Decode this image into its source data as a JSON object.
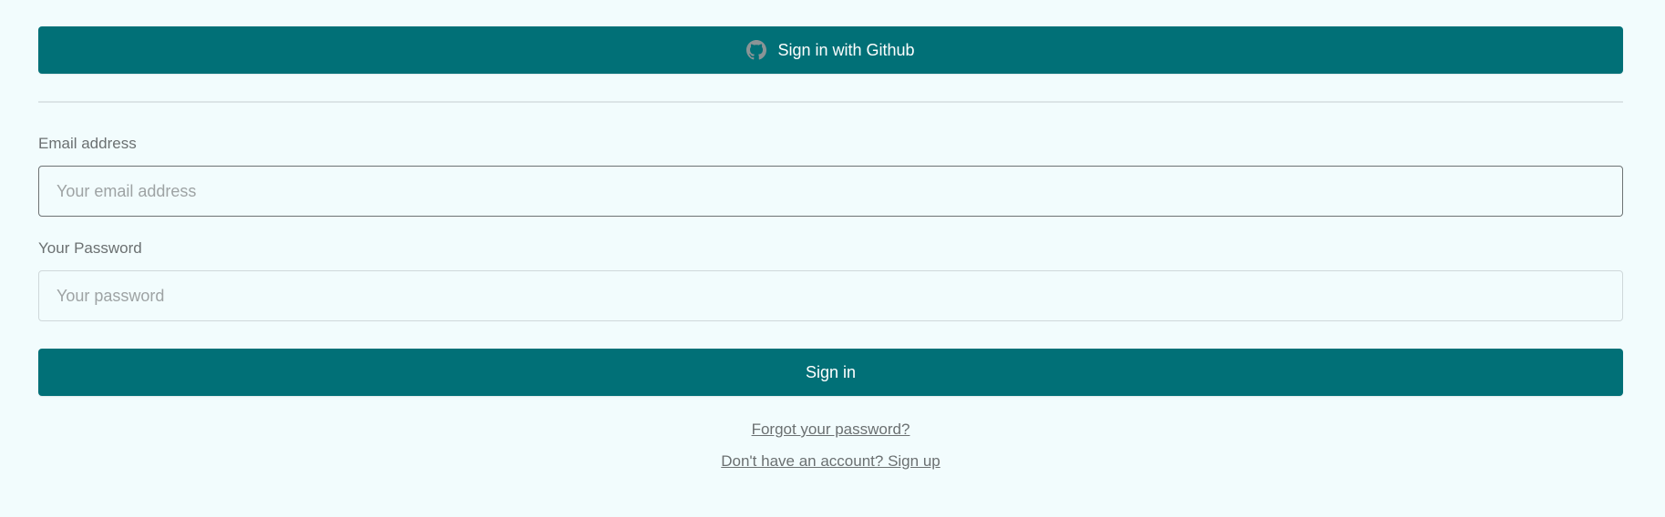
{
  "github_button": {
    "label": "Sign in with Github",
    "icon": "github-icon"
  },
  "email": {
    "label": "Email address",
    "placeholder": "Your email address",
    "value": ""
  },
  "password": {
    "label": "Your Password",
    "placeholder": "Your password",
    "value": ""
  },
  "signin_button": {
    "label": "Sign in"
  },
  "links": {
    "forgot": "Forgot your password?",
    "signup": "Don't have an account? Sign up"
  },
  "colors": {
    "primary": "#017077",
    "background": "#f2fcfd",
    "label_text": "#6b7071"
  }
}
